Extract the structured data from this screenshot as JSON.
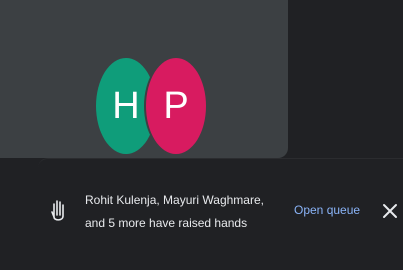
{
  "participants": [
    {
      "initial": "H",
      "color": "#0f9d7a"
    },
    {
      "initial": "P",
      "color": "#d81b60"
    }
  ],
  "toast": {
    "line1": "Rohit Kulenja, Mayuri Waghmare,",
    "line2": "and 5 more have raised hands",
    "action_label": "Open queue",
    "accent": "#8ab4f8",
    "icon": "raised-hand-icon",
    "close_icon": "close-icon"
  }
}
